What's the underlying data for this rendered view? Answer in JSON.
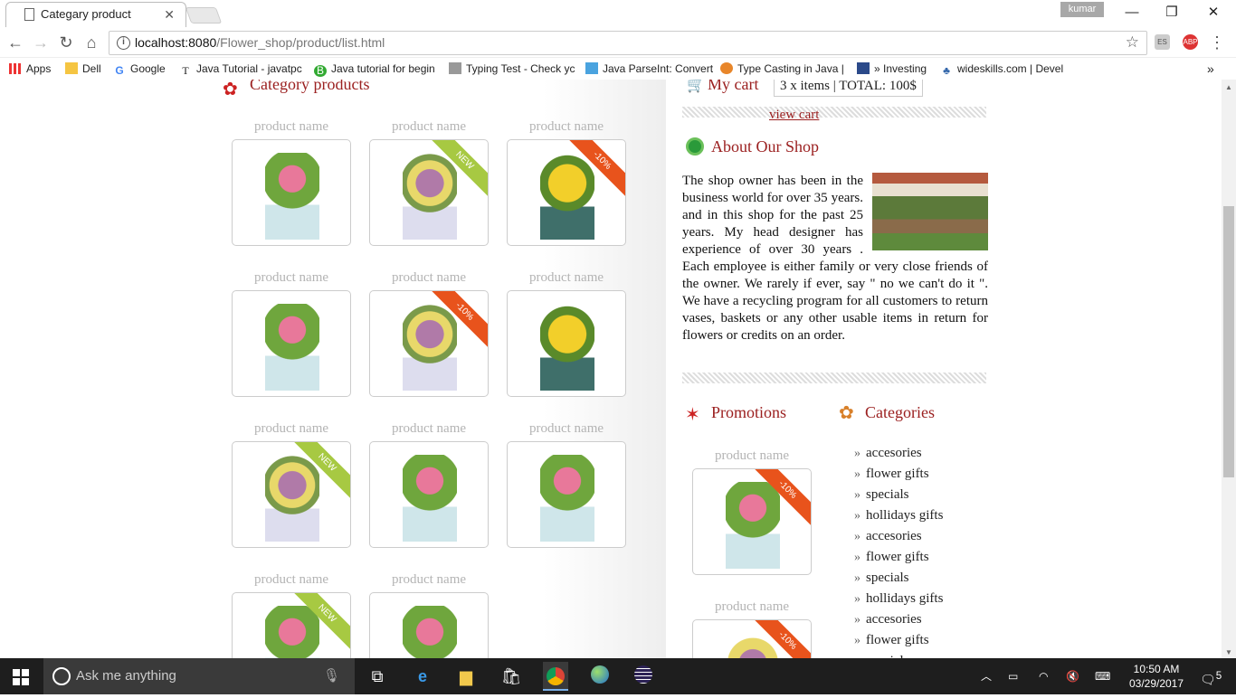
{
  "browser": {
    "tab_title": "Categary product",
    "user": "kumar",
    "url_host": "localhost:8080",
    "url_path": "/Flower_shop/product/list.html",
    "bookmarks": [
      "Apps",
      "Dell",
      "Google",
      "Java Tutorial - javatpc",
      "Java tutorial for begin",
      "Typing Test - Check yc",
      "Java ParseInt: Convert",
      "Type Casting in Java |",
      "» Investing",
      "wideskills.com | Devel"
    ],
    "more_bookmarks": "»"
  },
  "left": {
    "heading": "Category products",
    "product_label": "product name",
    "badges": {
      "new": "NEW",
      "sale": "-10%"
    }
  },
  "right": {
    "cart_heading": "My cart",
    "cart_summary": "3 x items | TOTAL: 100$",
    "view_cart": "view cart",
    "about_heading": "About Our Shop",
    "about_text": "The shop owner has been in the business world for over 35 years. and in this shop for the past 25 years. My head designer has experience of over 30 years . Each employee is either family or very close friends of the owner. We rarely if ever, say \" no we can't do it \". We have a recycling program for all customers to return vases, baskets or any other usable items in return for flowers or credits on an order.",
    "promotions_heading": "Promotions",
    "categories_heading": "Categories",
    "product_label": "product name",
    "categories": [
      "accesories",
      "flower gifts",
      "specials",
      "hollidays gifts",
      "accesories",
      "flower gifts",
      "specials",
      "hollidays gifts",
      "accesories",
      "flower gifts",
      "specials"
    ]
  },
  "taskbar": {
    "search_placeholder": "Ask me anything",
    "time": "10:50 AM",
    "date": "03/29/2017",
    "notifications": "5"
  },
  "colors": {
    "heading": "#9b2020",
    "new_badge": "#a7c942",
    "sale_badge": "#e8531c",
    "product_label": "#b4b4b4"
  }
}
